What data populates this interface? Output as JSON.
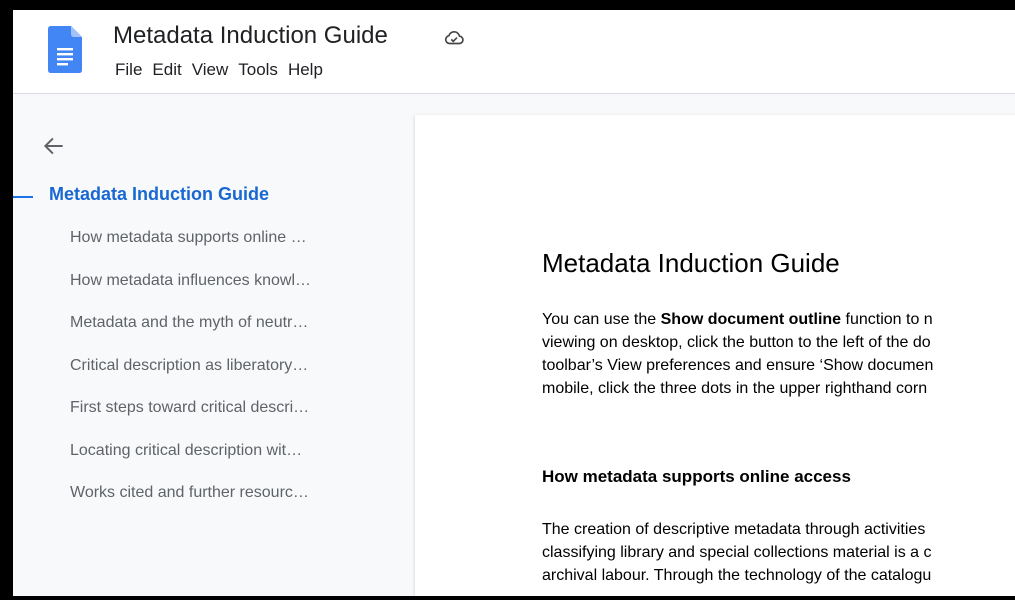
{
  "document": {
    "title": "Metadata Induction Guide"
  },
  "menu": [
    "File",
    "Edit",
    "View",
    "Tools",
    "Help"
  ],
  "colors": {
    "accent": "#1a73e8",
    "outline_title": "#1967d2",
    "logo": "#4285f4"
  },
  "icons": {
    "logo": "docs-logo-icon",
    "cloud": "cloud-saved-icon",
    "back": "arrow-back-icon"
  },
  "outline": {
    "title": "Metadata Induction Guide",
    "items": [
      "How metadata supports online …",
      "How metadata influences knowl…",
      "Metadata and the myth of neutr…",
      "Critical description as liberatory…",
      "First steps toward critical descri…",
      "Locating critical description wit…",
      "Works cited and further resourc…"
    ]
  },
  "page": {
    "heading": "Metadata Induction Guide",
    "intro": {
      "before": "You can use the ",
      "bold": "Show document outline",
      "after": " function to n",
      "lines": [
        "viewing on desktop, click the button to the left of the do",
        "toolbar’s View preferences and ensure ‘Show documen",
        "mobile, click the three dots in the upper righthand corn"
      ]
    },
    "subheading": "How metadata supports online access",
    "body_lines": [
      "The creation of descriptive metadata through activities",
      "classifying library and special collections material is a c",
      "archival labour. Through the technology of the catalogu"
    ]
  }
}
